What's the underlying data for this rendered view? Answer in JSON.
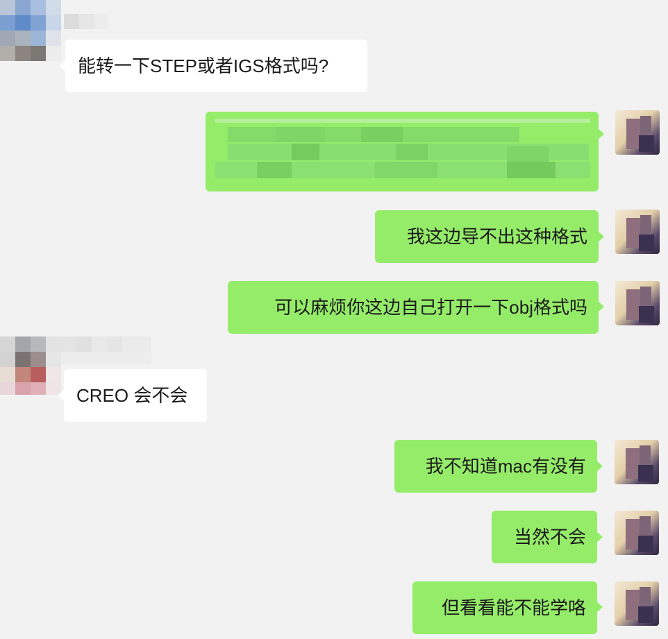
{
  "chat": {
    "messages": [
      {
        "direction": "in",
        "text": "能转一下STEP或者IGS格式吗?"
      },
      {
        "direction": "out",
        "text": ""
      },
      {
        "direction": "out",
        "text": "我这边导不出这种格式"
      },
      {
        "direction": "out",
        "text": "可以麻烦你这边自己打开一下obj格式吗"
      },
      {
        "direction": "in",
        "text": "CREO 会不会"
      },
      {
        "direction": "out",
        "text": "我不知道mac有没有"
      },
      {
        "direction": "out",
        "text": "当然不会"
      },
      {
        "direction": "out",
        "text": "但看看能不能学咯"
      }
    ]
  },
  "colors": {
    "background": "#f2f2f2",
    "incoming_bubble": "#ffffff",
    "outgoing_bubble": "#95ec69",
    "text": "#1a1a1a"
  }
}
